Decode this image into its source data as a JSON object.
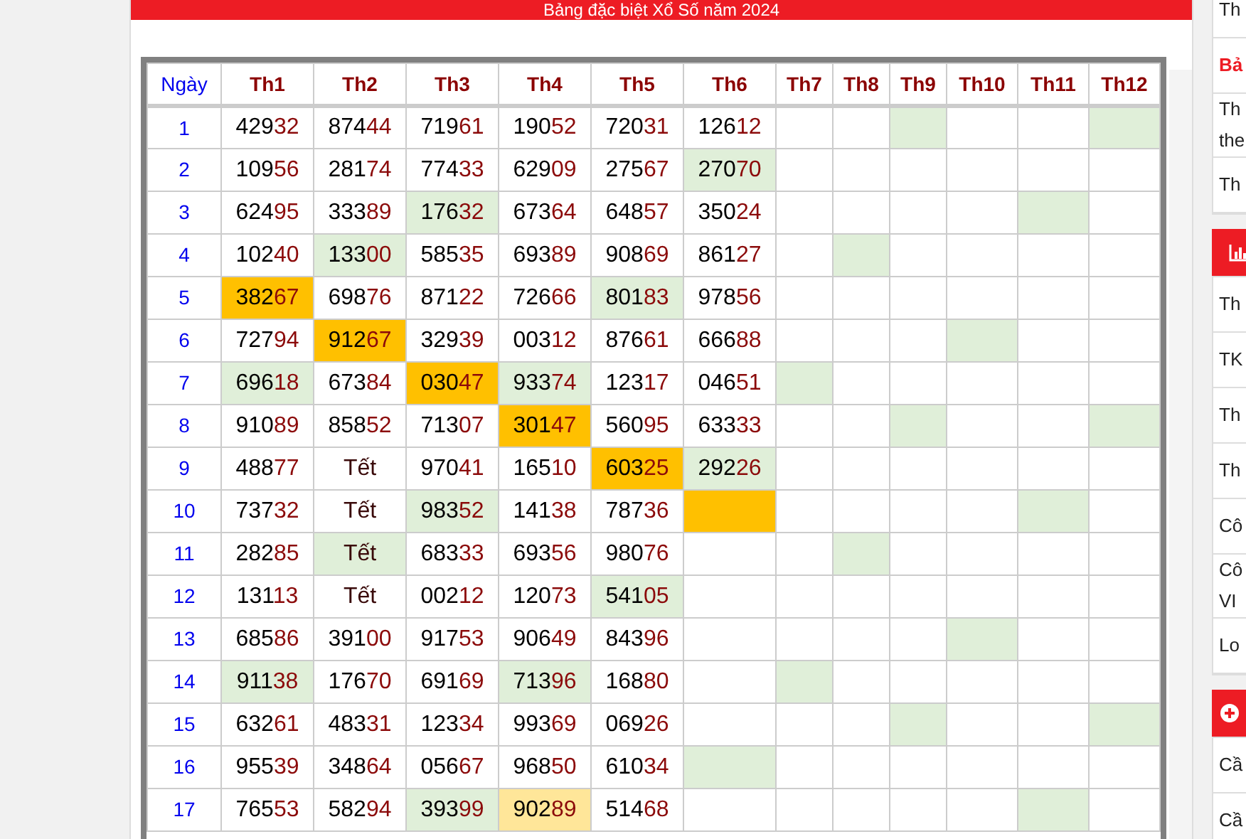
{
  "header": {
    "title": "Bảng đặc biệt Xổ Số năm 2024"
  },
  "table": {
    "day_header": "Ngày",
    "months": [
      "Th1",
      "Th2",
      "Th3",
      "Th4",
      "Th5",
      "Th6",
      "Th7",
      "Th8",
      "Th9",
      "Th10",
      "Th11",
      "Th12"
    ],
    "rows": [
      {
        "day": "1",
        "cells": [
          {
            "kind": "result",
            "value": "42932"
          },
          {
            "kind": "result",
            "value": "87444"
          },
          {
            "kind": "result",
            "value": "71961"
          },
          {
            "kind": "result",
            "value": "19052"
          },
          {
            "kind": "result",
            "value": "72031"
          },
          {
            "kind": "result",
            "value": "12612"
          },
          {
            "kind": "empty"
          },
          {
            "kind": "empty"
          },
          {
            "kind": "empty",
            "color": "#e0efd9"
          },
          {
            "kind": "empty"
          },
          {
            "kind": "empty"
          },
          {
            "kind": "empty",
            "color": "#e0efd9"
          }
        ]
      },
      {
        "day": "2",
        "cells": [
          {
            "kind": "result",
            "value": "10956"
          },
          {
            "kind": "result",
            "value": "28174"
          },
          {
            "kind": "result",
            "value": "77433"
          },
          {
            "kind": "result",
            "value": "62909"
          },
          {
            "kind": "result",
            "value": "27567"
          },
          {
            "kind": "result",
            "value": "27070",
            "color": "#e0efd9"
          },
          {
            "kind": "empty"
          },
          {
            "kind": "empty"
          },
          {
            "kind": "empty"
          },
          {
            "kind": "empty"
          },
          {
            "kind": "empty"
          },
          {
            "kind": "empty"
          }
        ]
      },
      {
        "day": "3",
        "cells": [
          {
            "kind": "result",
            "value": "62495"
          },
          {
            "kind": "result",
            "value": "33389"
          },
          {
            "kind": "result",
            "value": "17632",
            "color": "#e0efd9"
          },
          {
            "kind": "result",
            "value": "67364"
          },
          {
            "kind": "result",
            "value": "64857"
          },
          {
            "kind": "result",
            "value": "35024"
          },
          {
            "kind": "empty"
          },
          {
            "kind": "empty"
          },
          {
            "kind": "empty"
          },
          {
            "kind": "empty"
          },
          {
            "kind": "empty",
            "color": "#e0efd9"
          },
          {
            "kind": "empty"
          }
        ]
      },
      {
        "day": "4",
        "cells": [
          {
            "kind": "result",
            "value": "10240"
          },
          {
            "kind": "result",
            "value": "13300",
            "color": "#e0efd9"
          },
          {
            "kind": "result",
            "value": "58535"
          },
          {
            "kind": "result",
            "value": "69389"
          },
          {
            "kind": "result",
            "value": "90869"
          },
          {
            "kind": "result",
            "value": "86127"
          },
          {
            "kind": "empty"
          },
          {
            "kind": "empty",
            "color": "#e0efd9"
          },
          {
            "kind": "empty"
          },
          {
            "kind": "empty"
          },
          {
            "kind": "empty"
          },
          {
            "kind": "empty"
          }
        ]
      },
      {
        "day": "5",
        "cells": [
          {
            "kind": "result",
            "value": "38267",
            "color": "#ffc000"
          },
          {
            "kind": "result",
            "value": "69876"
          },
          {
            "kind": "result",
            "value": "87122"
          },
          {
            "kind": "result",
            "value": "72666"
          },
          {
            "kind": "result",
            "value": "80183",
            "color": "#e0efd9"
          },
          {
            "kind": "result",
            "value": "97856"
          },
          {
            "kind": "empty"
          },
          {
            "kind": "empty"
          },
          {
            "kind": "empty"
          },
          {
            "kind": "empty"
          },
          {
            "kind": "empty"
          },
          {
            "kind": "empty"
          }
        ]
      },
      {
        "day": "6",
        "cells": [
          {
            "kind": "result",
            "value": "72794"
          },
          {
            "kind": "result",
            "value": "91267",
            "color": "#ffc000"
          },
          {
            "kind": "result",
            "value": "32939"
          },
          {
            "kind": "result",
            "value": "00312"
          },
          {
            "kind": "result",
            "value": "87661"
          },
          {
            "kind": "result",
            "value": "66688"
          },
          {
            "kind": "empty"
          },
          {
            "kind": "empty"
          },
          {
            "kind": "empty"
          },
          {
            "kind": "empty",
            "color": "#e0efd9"
          },
          {
            "kind": "empty"
          },
          {
            "kind": "empty"
          }
        ]
      },
      {
        "day": "7",
        "cells": [
          {
            "kind": "result",
            "value": "69618",
            "color": "#e0efd9"
          },
          {
            "kind": "result",
            "value": "67384"
          },
          {
            "kind": "result",
            "value": "03047",
            "color": "#ffc000"
          },
          {
            "kind": "result",
            "value": "93374",
            "color": "#e0efd9"
          },
          {
            "kind": "result",
            "value": "12317"
          },
          {
            "kind": "result",
            "value": "04651"
          },
          {
            "kind": "empty",
            "color": "#e0efd9"
          },
          {
            "kind": "empty"
          },
          {
            "kind": "empty"
          },
          {
            "kind": "empty"
          },
          {
            "kind": "empty"
          },
          {
            "kind": "empty"
          }
        ]
      },
      {
        "day": "8",
        "cells": [
          {
            "kind": "result",
            "value": "91089"
          },
          {
            "kind": "result",
            "value": "85852"
          },
          {
            "kind": "result",
            "value": "71307"
          },
          {
            "kind": "result",
            "value": "30147",
            "color": "#ffc000"
          },
          {
            "kind": "result",
            "value": "56095"
          },
          {
            "kind": "result",
            "value": "63333"
          },
          {
            "kind": "empty"
          },
          {
            "kind": "empty"
          },
          {
            "kind": "empty",
            "color": "#e0efd9"
          },
          {
            "kind": "empty"
          },
          {
            "kind": "empty"
          },
          {
            "kind": "empty",
            "color": "#e0efd9"
          }
        ]
      },
      {
        "day": "9",
        "cells": [
          {
            "kind": "result",
            "value": "48877"
          },
          {
            "kind": "holiday",
            "value": "Tết"
          },
          {
            "kind": "result",
            "value": "97041"
          },
          {
            "kind": "result",
            "value": "16510"
          },
          {
            "kind": "result",
            "value": "60325",
            "color": "#ffc000"
          },
          {
            "kind": "result",
            "value": "29226",
            "color": "#e0efd9"
          },
          {
            "kind": "empty"
          },
          {
            "kind": "empty"
          },
          {
            "kind": "empty"
          },
          {
            "kind": "empty"
          },
          {
            "kind": "empty"
          },
          {
            "kind": "empty"
          }
        ]
      },
      {
        "day": "10",
        "cells": [
          {
            "kind": "result",
            "value": "73732"
          },
          {
            "kind": "holiday",
            "value": "Tết"
          },
          {
            "kind": "result",
            "value": "98352",
            "color": "#e0efd9"
          },
          {
            "kind": "result",
            "value": "14138"
          },
          {
            "kind": "result",
            "value": "78736"
          },
          {
            "kind": "empty",
            "color": "#ffc000"
          },
          {
            "kind": "empty"
          },
          {
            "kind": "empty"
          },
          {
            "kind": "empty"
          },
          {
            "kind": "empty"
          },
          {
            "kind": "empty",
            "color": "#e0efd9"
          },
          {
            "kind": "empty"
          }
        ]
      },
      {
        "day": "11",
        "cells": [
          {
            "kind": "result",
            "value": "28285"
          },
          {
            "kind": "holiday",
            "value": "Tết",
            "color": "#e0efd9"
          },
          {
            "kind": "result",
            "value": "68333"
          },
          {
            "kind": "result",
            "value": "69356"
          },
          {
            "kind": "result",
            "value": "98076"
          },
          {
            "kind": "empty"
          },
          {
            "kind": "empty"
          },
          {
            "kind": "empty",
            "color": "#e0efd9"
          },
          {
            "kind": "empty"
          },
          {
            "kind": "empty"
          },
          {
            "kind": "empty"
          },
          {
            "kind": "empty"
          }
        ]
      },
      {
        "day": "12",
        "cells": [
          {
            "kind": "result",
            "value": "13113"
          },
          {
            "kind": "holiday",
            "value": "Tết"
          },
          {
            "kind": "result",
            "value": "00212"
          },
          {
            "kind": "result",
            "value": "12073"
          },
          {
            "kind": "result",
            "value": "54105",
            "color": "#e0efd9"
          },
          {
            "kind": "empty"
          },
          {
            "kind": "empty"
          },
          {
            "kind": "empty"
          },
          {
            "kind": "empty"
          },
          {
            "kind": "empty"
          },
          {
            "kind": "empty"
          },
          {
            "kind": "empty"
          }
        ]
      },
      {
        "day": "13",
        "cells": [
          {
            "kind": "result",
            "value": "68586"
          },
          {
            "kind": "result",
            "value": "39100"
          },
          {
            "kind": "result",
            "value": "91753"
          },
          {
            "kind": "result",
            "value": "90649"
          },
          {
            "kind": "result",
            "value": "84396"
          },
          {
            "kind": "empty"
          },
          {
            "kind": "empty"
          },
          {
            "kind": "empty"
          },
          {
            "kind": "empty"
          },
          {
            "kind": "empty",
            "color": "#e0efd9"
          },
          {
            "kind": "empty"
          },
          {
            "kind": "empty"
          }
        ]
      },
      {
        "day": "14",
        "cells": [
          {
            "kind": "result",
            "value": "91138",
            "color": "#e0efd9"
          },
          {
            "kind": "result",
            "value": "17670"
          },
          {
            "kind": "result",
            "value": "69169"
          },
          {
            "kind": "result",
            "value": "71396",
            "color": "#e0efd9"
          },
          {
            "kind": "result",
            "value": "16880"
          },
          {
            "kind": "empty"
          },
          {
            "kind": "empty",
            "color": "#e0efd9"
          },
          {
            "kind": "empty"
          },
          {
            "kind": "empty"
          },
          {
            "kind": "empty"
          },
          {
            "kind": "empty"
          },
          {
            "kind": "empty"
          }
        ]
      },
      {
        "day": "15",
        "cells": [
          {
            "kind": "result",
            "value": "63261"
          },
          {
            "kind": "result",
            "value": "48331"
          },
          {
            "kind": "result",
            "value": "12334"
          },
          {
            "kind": "result",
            "value": "99369"
          },
          {
            "kind": "result",
            "value": "06926"
          },
          {
            "kind": "empty"
          },
          {
            "kind": "empty"
          },
          {
            "kind": "empty"
          },
          {
            "kind": "empty",
            "color": "#e0efd9"
          },
          {
            "kind": "empty"
          },
          {
            "kind": "empty"
          },
          {
            "kind": "empty",
            "color": "#e0efd9"
          }
        ]
      },
      {
        "day": "16",
        "cells": [
          {
            "kind": "result",
            "value": "95539"
          },
          {
            "kind": "result",
            "value": "34864"
          },
          {
            "kind": "result",
            "value": "05667"
          },
          {
            "kind": "result",
            "value": "96850"
          },
          {
            "kind": "result",
            "value": "61034"
          },
          {
            "kind": "empty",
            "color": "#e0efd9"
          },
          {
            "kind": "empty"
          },
          {
            "kind": "empty"
          },
          {
            "kind": "empty"
          },
          {
            "kind": "empty"
          },
          {
            "kind": "empty"
          },
          {
            "kind": "empty"
          }
        ]
      },
      {
        "day": "17",
        "cells": [
          {
            "kind": "result",
            "value": "76553"
          },
          {
            "kind": "result",
            "value": "58294"
          },
          {
            "kind": "result",
            "value": "39399",
            "color": "#e0efd9"
          },
          {
            "kind": "result",
            "value": "90289",
            "color": "#ffe699"
          },
          {
            "kind": "result",
            "value": "51468"
          },
          {
            "kind": "empty"
          },
          {
            "kind": "empty"
          },
          {
            "kind": "empty"
          },
          {
            "kind": "empty"
          },
          {
            "kind": "empty"
          },
          {
            "kind": "empty",
            "color": "#e0efd9"
          },
          {
            "kind": "empty"
          }
        ]
      }
    ]
  },
  "sidebar": {
    "blocks": [
      {
        "kind": "list",
        "items": [
          {
            "lines": [
              "Th"
            ],
            "emphasis": false
          },
          {
            "lines": [
              "Bả"
            ],
            "emphasis": true
          },
          {
            "lines": [
              "Th",
              "the"
            ],
            "emphasis": false
          },
          {
            "lines": [
              "Th"
            ],
            "emphasis": false
          }
        ]
      },
      {
        "kind": "stats-section",
        "items": [
          {
            "lines": [
              "Th"
            ],
            "emphasis": false
          },
          {
            "lines": [
              "TK"
            ],
            "emphasis": false
          },
          {
            "lines": [
              "Th"
            ],
            "emphasis": false
          },
          {
            "lines": [
              "Th"
            ],
            "emphasis": false
          },
          {
            "lines": [
              "Cô"
            ],
            "emphasis": false
          },
          {
            "lines": [
              "Cô",
              "VI"
            ],
            "emphasis": false
          },
          {
            "lines": [
              "Lo"
            ],
            "emphasis": false
          }
        ]
      },
      {
        "kind": "add-section",
        "items": [
          {
            "lines": [
              "Cầ"
            ],
            "emphasis": false
          },
          {
            "lines": [
              "Cầ"
            ],
            "emphasis": false
          }
        ]
      }
    ]
  }
}
